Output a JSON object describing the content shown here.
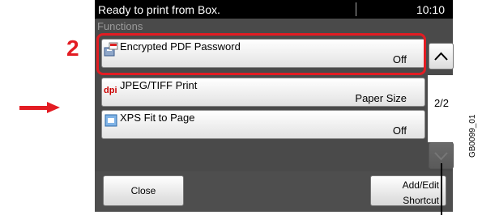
{
  "callout": {
    "step_number": "2"
  },
  "status_bar": {
    "message": "Ready to print from Box.",
    "time": "10:10"
  },
  "section": {
    "title": "Functions"
  },
  "items": [
    {
      "label": "Encrypted PDF Password",
      "value": "Off",
      "icon": "pdf-lock-icon"
    },
    {
      "label": "JPEG/TIFF Print",
      "value": "Paper Size",
      "icon": "dpi-icon"
    },
    {
      "label": "XPS Fit to Page",
      "value": "Off",
      "icon": "xps-icon"
    }
  ],
  "pager": {
    "indicator": "2/2"
  },
  "buttons": {
    "close": "Close",
    "shortcut_line1": "Add/Edit",
    "shortcut_line2": "Shortcut"
  },
  "figure_code": "GB0099_01",
  "colors": {
    "accent": "#e31c23",
    "screen_bg": "#4a4a4a",
    "status_bg": "#000000"
  }
}
